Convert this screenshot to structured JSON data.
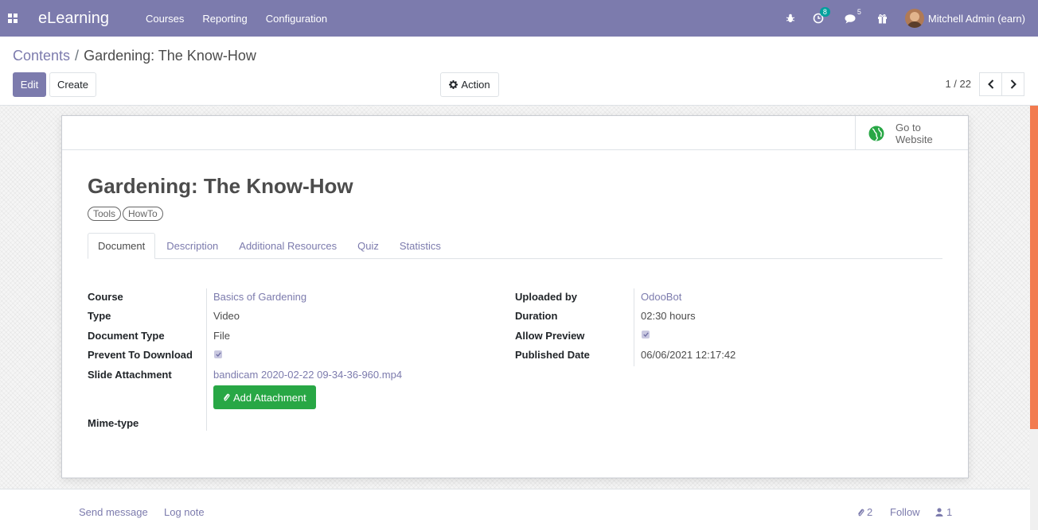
{
  "navbar": {
    "brand": "eLearning",
    "menu": [
      "Courses",
      "Reporting",
      "Configuration"
    ],
    "activity_count": "8",
    "messages_count": "5",
    "user_name": "Mitchell Admin (earn)"
  },
  "breadcrumb": {
    "parent": "Contents",
    "separator": "/",
    "current": "Gardening: The Know-How"
  },
  "toolbar": {
    "edit_label": "Edit",
    "create_label": "Create",
    "action_label": "Action",
    "pager": "1 / 22"
  },
  "record": {
    "go_to_website": "Go to Website",
    "title": "Gardening: The Know-How",
    "tags": [
      "Tools",
      "HowTo"
    ],
    "tabs": [
      "Document",
      "Description",
      "Additional Resources",
      "Quiz",
      "Statistics"
    ],
    "active_tab": "Document",
    "left_fields": {
      "course_label": "Course",
      "course_value": "Basics of Gardening",
      "type_label": "Type",
      "type_value": "Video",
      "doc_type_label": "Document Type",
      "doc_type_value": "File",
      "prevent_download_label": "Prevent To Download",
      "prevent_download_checked": true,
      "attachment_label": "Slide Attachment",
      "attachment_value": "bandicam 2020-02-22 09-34-36-960.mp4",
      "add_attachment_label": "Add Attachment",
      "mimetype_label": "Mime-type"
    },
    "right_fields": {
      "uploaded_by_label": "Uploaded by",
      "uploaded_by_value": "OdooBot",
      "duration_label": "Duration",
      "duration_value": "02:30 hours",
      "allow_preview_label": "Allow Preview",
      "allow_preview_checked": true,
      "published_date_label": "Published Date",
      "published_date_value": "06/06/2021 12:17:42"
    }
  },
  "chatter": {
    "send_message": "Send message",
    "log_note": "Log note",
    "attachments_count": "2",
    "follow": "Follow",
    "followers_count": "1"
  },
  "colors": {
    "brand": "#7c7bad",
    "success": "#28a745",
    "badge": "#00a09d",
    "scrollbar": "#f27b4f"
  }
}
